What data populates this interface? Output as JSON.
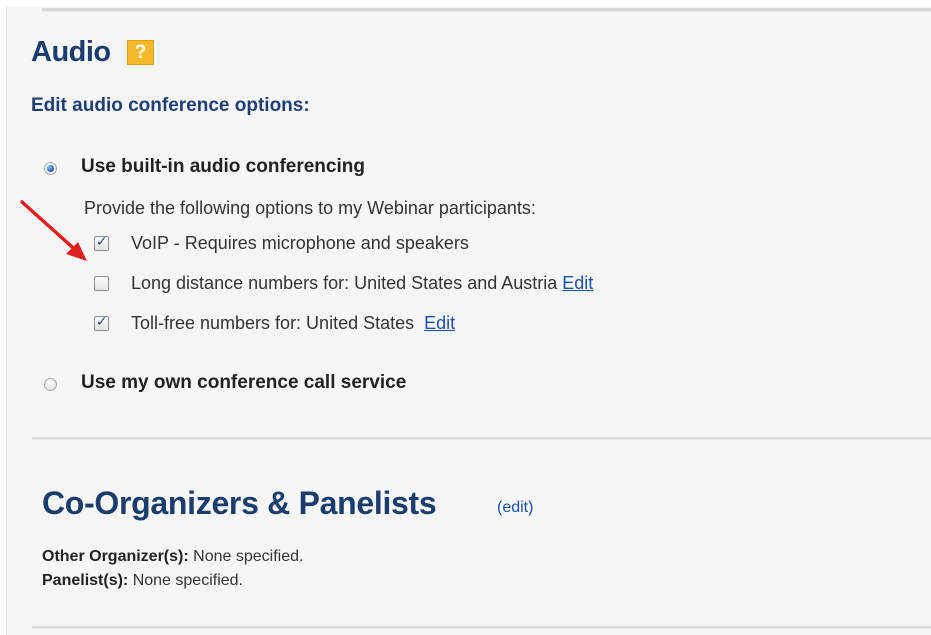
{
  "audio": {
    "title": "Audio",
    "help_icon": "?",
    "subtitle": "Edit audio conference options:",
    "option_builtin": "Use built-in audio conferencing",
    "provide_text": "Provide the following options to my Webinar participants:",
    "voip_label": "VoIP - Requires microphone and speakers",
    "voip_checked": true,
    "longdist_label": "Long distance numbers for: United States and Austria",
    "longdist_checked": false,
    "longdist_edit": "Edit",
    "tollfree_label": "Toll-free numbers for: United States",
    "tollfree_checked": true,
    "tollfree_edit": "Edit",
    "option_own": "Use my own conference call service",
    "selected_option": "builtin"
  },
  "coorganizers": {
    "title": "Co-Organizers & Panelists",
    "edit_label": "(edit)",
    "other_organizers_label": "Other Organizer(s):",
    "other_organizers_value": "None specified.",
    "panelists_label": "Panelist(s):",
    "panelists_value": "None specified."
  },
  "colors": {
    "heading": "#1b3d6d",
    "link": "#1c4fa8",
    "arrow": "#e02020",
    "help_icon": "#f5b92a"
  },
  "icons": {
    "help": "help-icon",
    "annotation_arrow": "red-arrow-icon"
  }
}
